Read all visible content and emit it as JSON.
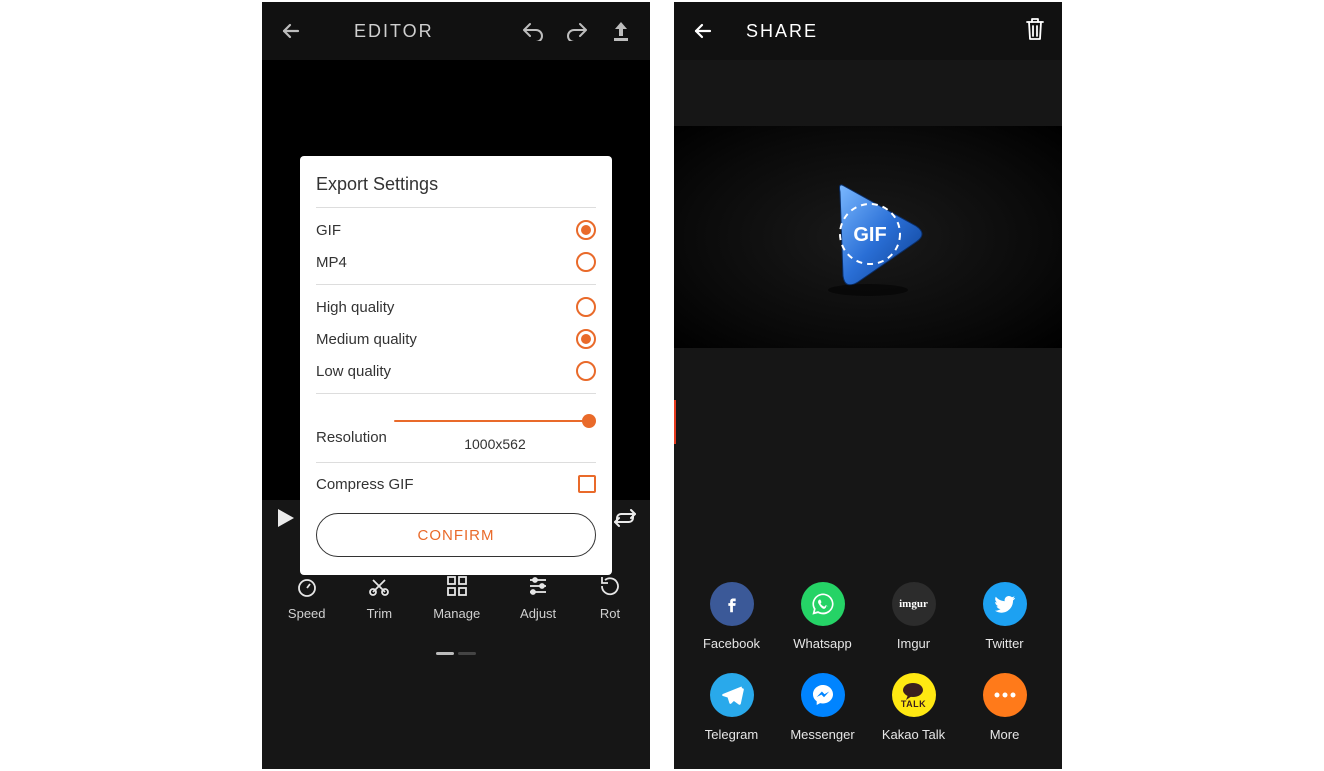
{
  "editor": {
    "title": "EDITOR",
    "modal": {
      "heading": "Export Settings",
      "format": {
        "options": [
          {
            "label": "GIF",
            "selected": true
          },
          {
            "label": "MP4",
            "selected": false
          }
        ]
      },
      "quality": {
        "options": [
          {
            "label": "High quality",
            "selected": false
          },
          {
            "label": "Medium quality",
            "selected": true
          },
          {
            "label": "Low quality",
            "selected": false
          }
        ]
      },
      "resolution": {
        "label": "Resolution",
        "value": "1000x562",
        "slider_pct": 100
      },
      "compress": {
        "label": "Compress GIF",
        "checked": false
      },
      "confirm": "CONFIRM"
    },
    "tools": [
      {
        "name": "Speed"
      },
      {
        "name": "Trim"
      },
      {
        "name": "Manage"
      },
      {
        "name": "Adjust"
      },
      {
        "name": "Rot"
      }
    ]
  },
  "share": {
    "title": "SHARE",
    "badge_text": "GIF",
    "options": [
      {
        "label": "Facebook",
        "style": "round-fb"
      },
      {
        "label": "Whatsapp",
        "style": "round-wa"
      },
      {
        "label": "Imgur",
        "style": "round-imgur"
      },
      {
        "label": "Twitter",
        "style": "round-tw"
      },
      {
        "label": "Telegram",
        "style": "round-tg"
      },
      {
        "label": "Messenger",
        "style": "round-ms"
      },
      {
        "label": "Kakao Talk",
        "style": "round-kt"
      },
      {
        "label": "More",
        "style": "round-more"
      }
    ],
    "imgur_text": "imgur",
    "kakao_talk_text": "TALK"
  }
}
